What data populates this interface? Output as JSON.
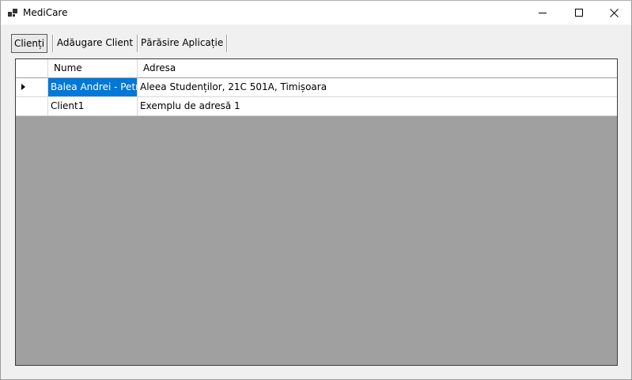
{
  "window": {
    "title": "MediCare",
    "app_icon": "app-window-icon",
    "controls": {
      "minimize_icon": "minimize-icon",
      "maximize_icon": "maximize-icon",
      "close_icon": "close-icon"
    }
  },
  "menu": {
    "items": [
      {
        "label": "Clienți",
        "active": true
      },
      {
        "label": "Adăugare Client",
        "active": false
      },
      {
        "label": "Părăsire Aplicație",
        "active": false
      }
    ]
  },
  "grid": {
    "columns": [
      "Nume",
      "Adresa"
    ],
    "rows": [
      {
        "nume": "Balea Andrei - Petru",
        "adresa": "Aleea Studenților, 21C 501A, Timișoara",
        "current": true
      },
      {
        "nume": "Client1",
        "adresa": "Exemplu de adresă 1",
        "current": false
      }
    ],
    "colors": {
      "selection": "#0078d7",
      "empty_area": "#a0a0a0"
    }
  }
}
